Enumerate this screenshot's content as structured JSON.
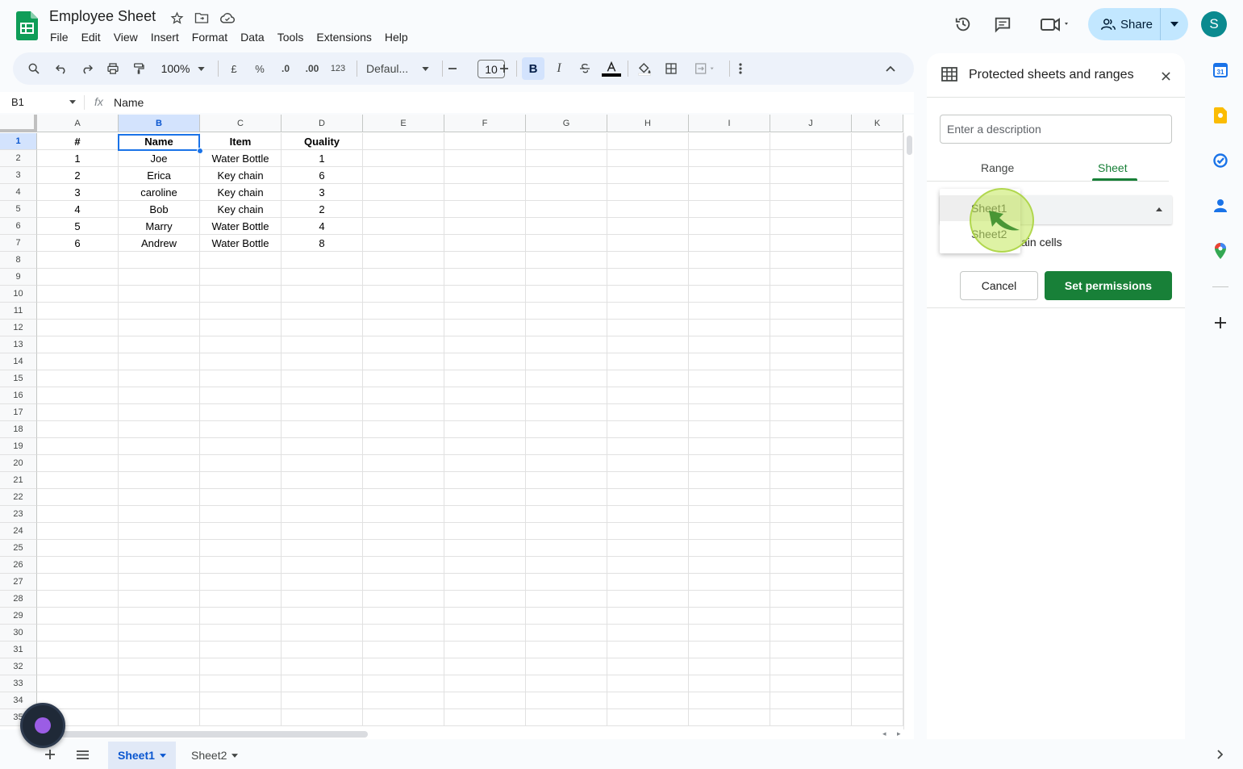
{
  "app": {
    "title": "Employee Sheet",
    "menu": [
      "File",
      "Edit",
      "View",
      "Insert",
      "Format",
      "Data",
      "Tools",
      "Extensions",
      "Help"
    ],
    "share_label": "Share",
    "avatar_letter": "S"
  },
  "toolbar": {
    "zoom": "100%",
    "currency": "£",
    "percent": "%",
    "dec_decrease": ".0",
    "dec_increase": ".00",
    "number_format": "123",
    "font": "Defaul...",
    "font_size": "10",
    "bold": "B",
    "italic": "I"
  },
  "formula_bar": {
    "cell_ref": "B1",
    "fx": "fx",
    "content": "Name"
  },
  "grid": {
    "columns": [
      "A",
      "B",
      "C",
      "D",
      "E",
      "F",
      "G",
      "H",
      "I",
      "J",
      "K"
    ],
    "selected_column": "B",
    "rows": [
      [
        "#",
        "Name",
        "Item",
        "Quality"
      ],
      [
        "1",
        "Joe",
        "Water Bottle",
        "1"
      ],
      [
        "2",
        "Erica",
        "Key chain",
        "6"
      ],
      [
        "3",
        "caroline",
        "Key chain",
        "3"
      ],
      [
        "4",
        "Bob",
        "Key chain",
        "2"
      ],
      [
        "5",
        "Marry",
        "Water Bottle",
        "4"
      ],
      [
        "6",
        "Andrew",
        "Water Bottle",
        "8"
      ]
    ],
    "row_numbers": [
      "1",
      "2",
      "3",
      "4",
      "5",
      "6",
      "7",
      "8",
      "9",
      "10",
      "11",
      "12",
      "13",
      "14",
      "15",
      "16",
      "17",
      "18",
      "19",
      "20",
      "21",
      "22",
      "23",
      "24",
      "25",
      "26",
      "27",
      "28",
      "29",
      "30",
      "31",
      "32",
      "33",
      "34",
      "35"
    ]
  },
  "sheets": {
    "tabs": [
      "Sheet1",
      "Sheet2"
    ],
    "active": "Sheet1"
  },
  "panel": {
    "title": "Protected sheets and ranges",
    "description_placeholder": "Enter a description",
    "tab_range": "Range",
    "tab_sheet": "Sheet",
    "except_text": "ain cells",
    "dropdown_options": [
      "Sheet1",
      "Sheet2"
    ],
    "cancel_label": "Cancel",
    "set_permissions_label": "Set permissions"
  },
  "colors": {
    "accent_green": "#188038",
    "selection_blue": "#1a73e8",
    "share_bg": "#c2e7ff"
  }
}
